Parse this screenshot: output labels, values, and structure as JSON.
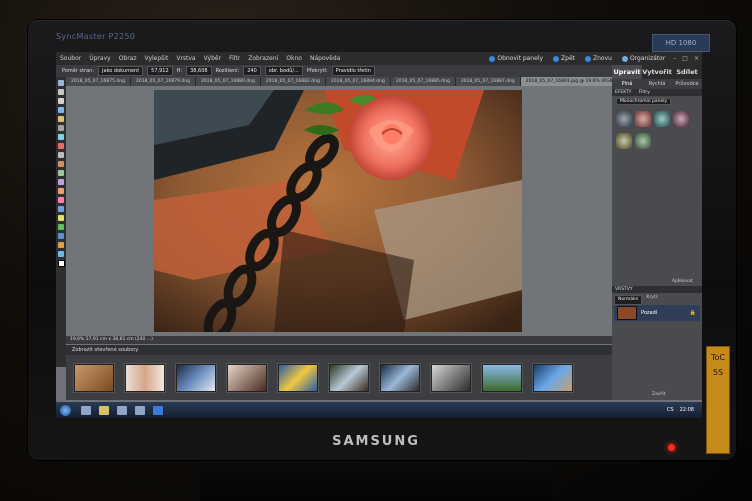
{
  "monitor": {
    "model_label": "SyncMaster P2250",
    "brand": "SAMSUNG",
    "badge": "HD 1080",
    "sticker_top": "ToC",
    "sticker_mid": "5S"
  },
  "menubar": {
    "items": [
      "Soubor",
      "Úpravy",
      "Obraz",
      "Vylepšit",
      "Vrstva",
      "Výběr",
      "Filtr",
      "Zobrazení",
      "Okno",
      "Nápověda"
    ],
    "right_buttons": [
      "Obnovit panely",
      "Zpět",
      "Znovu",
      "Organizátor"
    ]
  },
  "options_bar": {
    "size_label": "Poměr stran:",
    "size_value": "Jako dokument",
    "width_value": "57,912",
    "height_label": "H:",
    "height_value": "38,608",
    "resolution_label": "Rozlišení:",
    "resolution_value": "240",
    "unit_value": "obr. bodů/...",
    "overlay_label": "Překrytí:",
    "overlay_value": "Pravidlo třetin"
  },
  "doc_tabs": [
    "2018_05_07_16875.dng",
    "2018_05_07_16879.dng",
    "2018_05_07_16880.dng",
    "2018_05_07_16882.dng",
    "2018_05_07_16884.dng",
    "2018_05_07_16885.dng",
    "2018_05_07_16887.dng",
    "2018_05_07_16891.jpg @ 19,6% (RGB/8)"
  ],
  "status_bar": "19,6%   57,91 cm x 38,61 cm (240 ...)",
  "photo_bin": {
    "header": "Zobrazit otevřené soubory"
  },
  "panel": {
    "tabs": [
      "Upravit",
      "Vytvořit",
      "Sdílet"
    ],
    "subtabs": [
      "Plná",
      "Rychlá",
      "Průvodce"
    ],
    "effects_label": "EFEKTY",
    "effects_sub": "Filtry",
    "dropdown": "Monochromní panely",
    "layers_label": "VRSTVY",
    "layer_mode": "Normální",
    "layer_opacity": "Krytí:",
    "layer_name": "Pozadí",
    "apply_button": "Aplikovat",
    "footer_label": "Zavřít"
  },
  "taskbar": {
    "lang": "CS",
    "time": "22:08"
  },
  "colors": {
    "accent": "#2f3d57",
    "power_led": "#ff2a1a"
  }
}
